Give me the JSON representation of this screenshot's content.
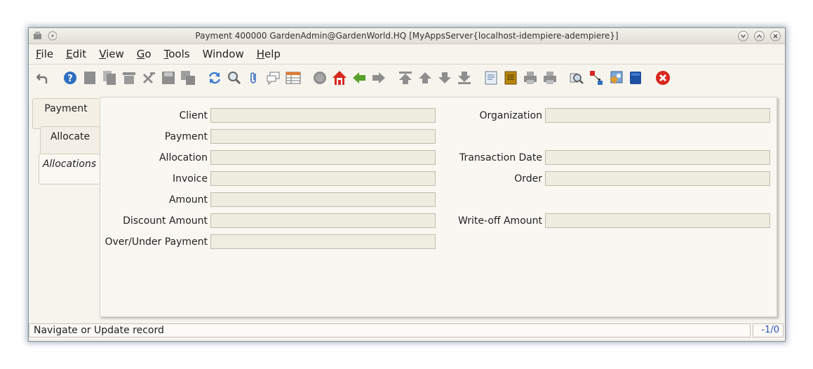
{
  "window": {
    "title": "Payment  400000  GardenAdmin@GardenWorld.HQ [MyAppsServer{localhost-idempiere-adempiere}]"
  },
  "menu": {
    "items": [
      {
        "label": "File",
        "mnemonic": "F"
      },
      {
        "label": "Edit",
        "mnemonic": "E"
      },
      {
        "label": "View",
        "mnemonic": "V"
      },
      {
        "label": "Go",
        "mnemonic": "G"
      },
      {
        "label": "Tools",
        "mnemonic": "T"
      },
      {
        "label": "Window",
        "mnemonic": ""
      },
      {
        "label": "Help",
        "mnemonic": "H"
      }
    ]
  },
  "toolbar": {
    "icons": [
      "undo-icon",
      "help-icon",
      "new-record-icon",
      "copy-record-icon",
      "delete-icon",
      "delete-selection-icon",
      "save-icon",
      "save-and-create-icon",
      "refresh-icon",
      "find-icon",
      "attachment-icon",
      "chat-icon",
      "grid-toggle-icon",
      "history-icon",
      "home-icon",
      "parent-record-icon",
      "detail-record-icon",
      "first-record-icon",
      "previous-record-icon",
      "next-record-icon",
      "last-record-icon",
      "report-icon",
      "archived-documents-icon",
      "print-preview-icon",
      "print-icon",
      "zoom-across-icon",
      "request-icon",
      "product-info-icon",
      "workflow-icon",
      "end-window-icon"
    ]
  },
  "tabs": [
    {
      "label": "Payment"
    },
    {
      "label": "Allocate"
    },
    {
      "label": "Allocations"
    }
  ],
  "form": {
    "client": {
      "label": "Client",
      "value": ""
    },
    "organization": {
      "label": "Organization",
      "value": ""
    },
    "payment": {
      "label": "Payment",
      "value": ""
    },
    "allocation": {
      "label": "Allocation",
      "value": ""
    },
    "transaction_date": {
      "label": "Transaction Date",
      "value": ""
    },
    "invoice": {
      "label": "Invoice",
      "value": ""
    },
    "order": {
      "label": "Order",
      "value": ""
    },
    "amount": {
      "label": "Amount",
      "value": ""
    },
    "discount_amount": {
      "label": "Discount Amount",
      "value": ""
    },
    "writeoff_amount": {
      "label": "Write-off Amount",
      "value": ""
    },
    "over_under_payment": {
      "label": "Over/Under Payment",
      "value": ""
    }
  },
  "status": {
    "message": "Navigate or Update record",
    "record_count": "-1/0"
  }
}
